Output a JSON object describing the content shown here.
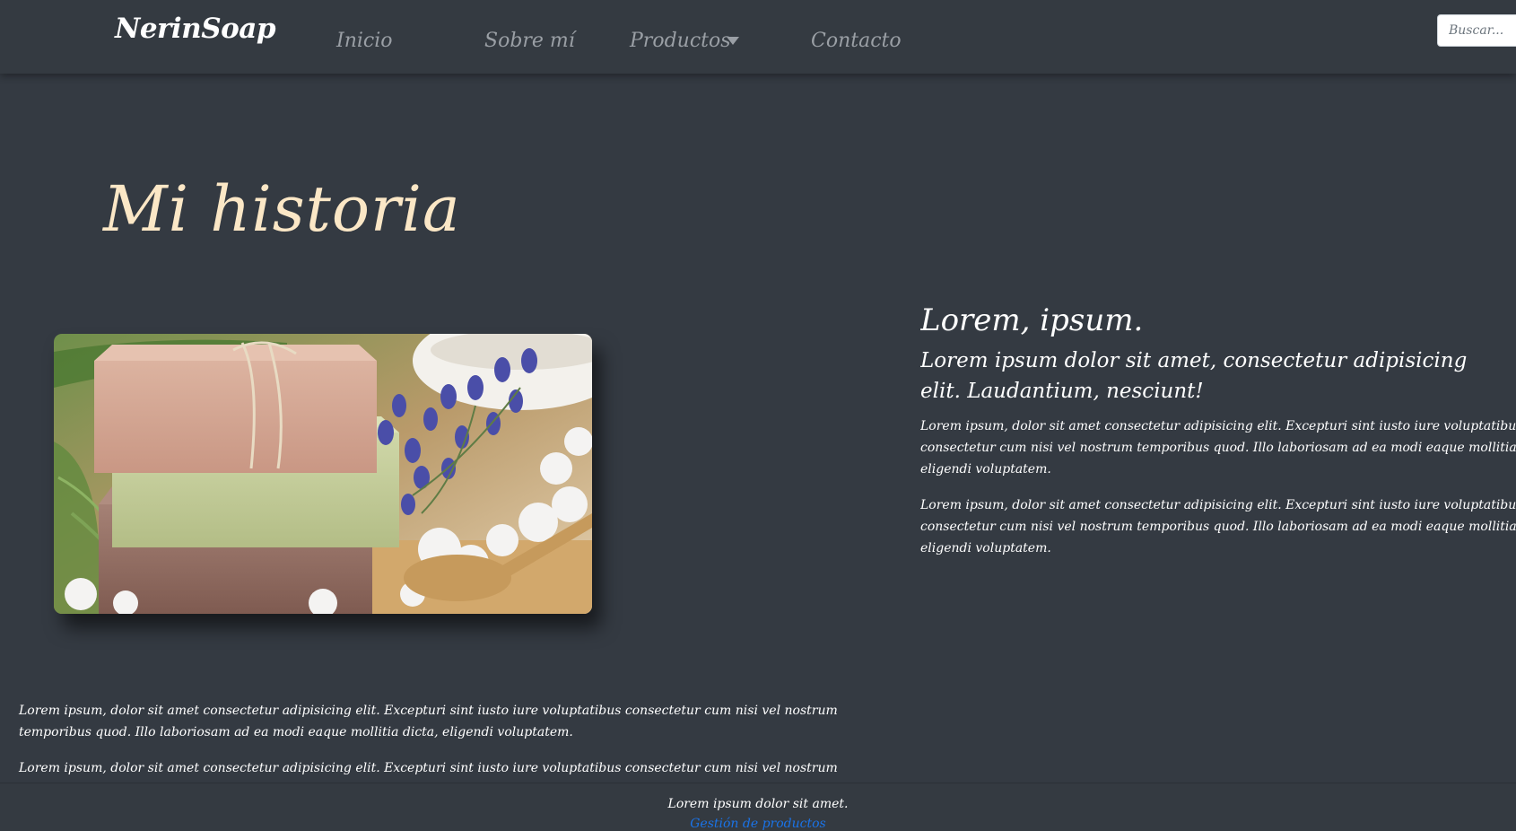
{
  "navbar": {
    "brand": "NerinSoap",
    "items": [
      {
        "label": "Inicio"
      },
      {
        "label": "Sobre mí"
      },
      {
        "label": "Productos"
      },
      {
        "label": "Contacto"
      }
    ],
    "search": {
      "placeholder": "Buscar..."
    }
  },
  "hero": {
    "title": "Mi historia"
  },
  "article": {
    "heading": "Lorem, ipsum.",
    "subheading": "Lorem ipsum dolor sit amet, consectetur adipisicing elit. Laudantium, nesciunt!",
    "paragraphs": [
      "Lorem ipsum, dolor sit amet consectetur adipisicing elit. Excepturi sint iusto iure voluptatibus consectetur cum nisi vel nostrum temporibus quod. Illo laboriosam ad ea modi eaque mollitia dicta, eligendi voluptatem.",
      "Lorem ipsum, dolor sit amet consectetur adipisicing elit. Excepturi sint iusto iure voluptatibus consectetur cum nisi vel nostrum temporibus quod. Illo laboriosam ad ea modi eaque mollitia dicta, eligendi voluptatem."
    ]
  },
  "story": {
    "paragraphs": [
      "Lorem ipsum, dolor sit amet consectetur adipisicing elit. Excepturi sint iusto iure voluptatibus consectetur cum nisi vel nostrum temporibus quod. Illo laboriosam ad ea modi eaque mollitia dicta, eligendi voluptatem.",
      "Lorem ipsum, dolor sit amet consectetur adipisicing elit. Excepturi sint iusto iure voluptatibus consectetur cum nisi vel nostrum temporibus quod."
    ]
  },
  "footer": {
    "text": "Lorem ipsum dolor sit amet.",
    "link": "Gestión de productos"
  },
  "colors": {
    "background": "#343a42",
    "title": "#fbe7c6",
    "nav_text": "#9a9fa5",
    "link": "#1a73e8"
  },
  "icons": {
    "dropdown": "caret-down-icon"
  }
}
